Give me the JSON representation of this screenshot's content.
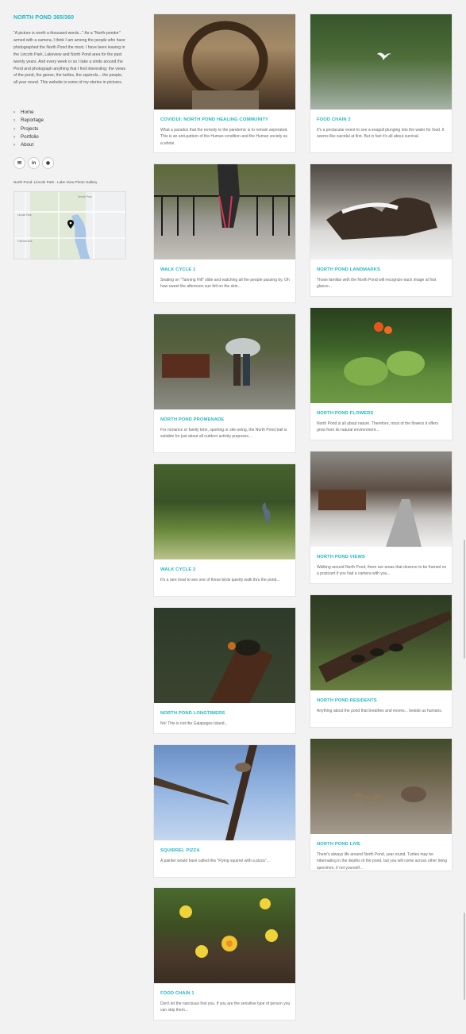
{
  "site": {
    "title": "NORTH POND 365/360",
    "intro": "\"A picture is worth a thousand words...\"  As a \"North-ponder\" armed with a camera, I think I am among the people who have photographed the North Pond the most. I have been leaving in the Lincoln Park, Lakeview and North Pond area for the past twenty years. And every week or so I take a stride around the Pond and photograph anything that I find interesting: the views of the pond, the geese, the turtles, the squirrels... the people, all year round. This website is some of my stories in pictures."
  },
  "menu": [
    {
      "label": "Home",
      "icon": "chevron-right-icon"
    },
    {
      "label": "Reportage",
      "icon": "chevron-right-icon"
    },
    {
      "label": "Projects",
      "icon": "chevron-right-icon"
    },
    {
      "label": "Portfolio",
      "icon": "chevron-right-icon"
    },
    {
      "label": "About",
      "icon": "chevron-right-icon"
    }
  ],
  "social": [
    {
      "name": "email-icon",
      "glyph": "✉"
    },
    {
      "name": "linkedin-icon",
      "glyph": "in"
    },
    {
      "name": "github-icon",
      "glyph": "◉"
    }
  ],
  "map": {
    "caption": "North Pond: Lincoln Park - Lake View Photo Gallery",
    "labels": [
      "Lincoln Park",
      "Lincoln Park",
      "Fullerton Ave"
    ]
  },
  "cards": [
    {
      "title": "COVID19: NORTH POND HEALING COMMUNITY",
      "excerpt": "What a paradox that the remedy to the pandemic is to remain seperated. This is an anti-pattern of the Human condition and the Human society as a whole."
    },
    {
      "title": "FOOD CHAIN 2",
      "excerpt": "It's a pectacular event to see a seagull plunging into the water for food. It seems like suicidal at first. But in fact it's all about survival."
    },
    {
      "title": "WALK CYCLE 1",
      "excerpt": "Seating on \"Tanning Hill\" slide and watching all the people passing by. Oh how sweet the afternoon sun felt on the skin..."
    },
    {
      "title": "NORTH POND LANDMARKS",
      "excerpt": "Those familiar with the North Pond will recognize each image at first glance..."
    },
    {
      "title": "NORTH POND PROMENADE",
      "excerpt": "For romance or family time, sporting or site-seing, the North Pond trail is suitable for just about all outdoor activity purposes..."
    },
    {
      "title": "NORTH POND FLOWERS",
      "excerpt": "North Pond is all about nature. Therefore, most of the flowers it offers grow from its natural environment..."
    },
    {
      "title": "WALK CYCLE 2",
      "excerpt": "It's a rare treat to see one of these birds quietly walk thru the pond..."
    },
    {
      "title": "NORTH POND VIEWS",
      "excerpt": "Walking around North Pond, there are areas that deserve to be framed on a postcard if you had a camera with you..."
    },
    {
      "title": "NORTH POND LONGTIMERS",
      "excerpt": "No! This is not the Galapagos Island..."
    },
    {
      "title": "NORTH POND RESIDENTS",
      "excerpt": "Anything about the pond that breathes and moves... beside us humans."
    },
    {
      "title": "SQUIRREL PIZZA",
      "excerpt": "A painter would have called this \"Flying squirrel with a pizza\"..."
    },
    {
      "title": "NORTH POND LIVE",
      "excerpt": "There's always life around North Pond, year round. Turtles may be hibernating in the depths of the pond, but you will come across other living specimen, if not yourself..."
    },
    {
      "title": "FOOD CHAIN 1",
      "excerpt": "Don't let the narcissus fool you. If you are the sensitive type of person you can skip them..."
    }
  ],
  "colors": {
    "accent": "#1fb7c7",
    "background": "#f2f2f2",
    "card": "#ffffff"
  }
}
